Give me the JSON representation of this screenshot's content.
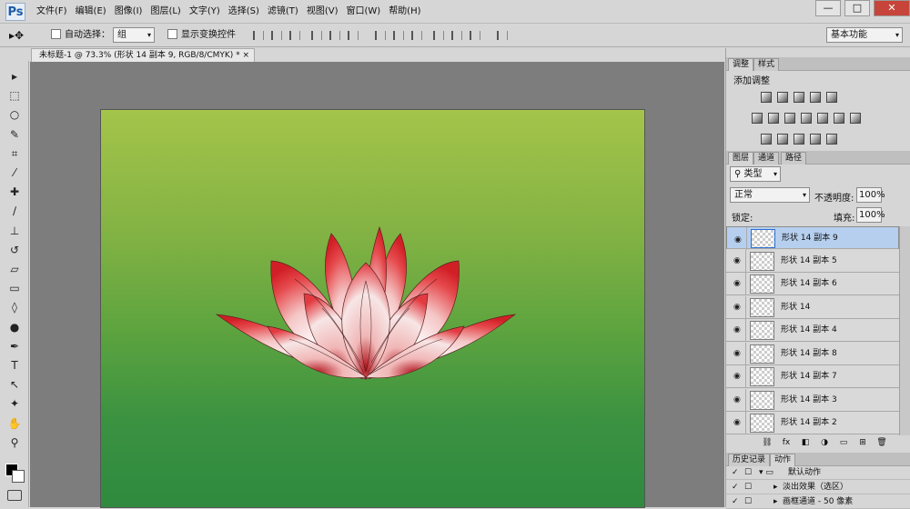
{
  "app": {
    "logo": "Ps"
  },
  "menu": [
    "文件(F)",
    "编辑(E)",
    "图像(I)",
    "图层(L)",
    "文字(Y)",
    "选择(S)",
    "滤镜(T)",
    "视图(V)",
    "窗口(W)",
    "帮助(H)"
  ],
  "window_controls": {
    "minimize": "—",
    "restore": "□",
    "close": "✕"
  },
  "options": {
    "auto_select_label": "自动选择：",
    "auto_select_value": "组",
    "show_transform_label": "显示变换控件",
    "workspace_value": "基本功能"
  },
  "document": {
    "tab_title": "未标题-1 @ 73.3% (形状 14 副本 9, RGB/8/CMYK) *",
    "close": "×"
  },
  "tools": [
    {
      "name": "move-tool-icon",
      "glyph": "▸"
    },
    {
      "name": "marquee-tool-icon",
      "glyph": "⬚"
    },
    {
      "name": "lasso-tool-icon",
      "glyph": "○"
    },
    {
      "name": "quick-select-tool-icon",
      "glyph": "✎"
    },
    {
      "name": "crop-tool-icon",
      "glyph": "⌗"
    },
    {
      "name": "eyedropper-tool-icon",
      "glyph": "⁄"
    },
    {
      "name": "healing-brush-tool-icon",
      "glyph": "✚"
    },
    {
      "name": "brush-tool-icon",
      "glyph": "∕"
    },
    {
      "name": "clone-stamp-tool-icon",
      "glyph": "⊥"
    },
    {
      "name": "history-brush-tool-icon",
      "glyph": "↺"
    },
    {
      "name": "eraser-tool-icon",
      "glyph": "▱"
    },
    {
      "name": "gradient-tool-icon",
      "glyph": "▭"
    },
    {
      "name": "blur-tool-icon",
      "glyph": "◊"
    },
    {
      "name": "dodge-tool-icon",
      "glyph": "●"
    },
    {
      "name": "pen-tool-icon",
      "glyph": "✒"
    },
    {
      "name": "type-tool-icon",
      "glyph": "T"
    },
    {
      "name": "path-select-tool-icon",
      "glyph": "↖"
    },
    {
      "name": "shape-tool-icon",
      "glyph": "✦"
    },
    {
      "name": "hand-tool-icon",
      "glyph": "✋"
    },
    {
      "name": "zoom-tool-icon",
      "glyph": "⚲"
    }
  ],
  "adjustments": {
    "tabs": [
      "调整",
      "样式"
    ],
    "title": "添加调整"
  },
  "layers_panel": {
    "tabs": [
      "图层",
      "通道",
      "路径"
    ],
    "filter_kind": "类型",
    "blend_mode": "正常",
    "opacity_label": "不透明度:",
    "opacity_value": "100%",
    "lock_label": "锁定:",
    "fill_label": "填充:",
    "fill_value": "100%",
    "layers": [
      {
        "name": "形状 14 副本 9",
        "selected": true
      },
      {
        "name": "形状 14 副本 5",
        "selected": false
      },
      {
        "name": "形状 14 副本 6",
        "selected": false
      },
      {
        "name": "形状 14",
        "selected": false
      },
      {
        "name": "形状 14 副本 4",
        "selected": false
      },
      {
        "name": "形状 14 副本 8",
        "selected": false
      },
      {
        "name": "形状 14 副本 7",
        "selected": false
      },
      {
        "name": "形状 14 副本 3",
        "selected": false
      },
      {
        "name": "形状 14 副本 2",
        "selected": false
      }
    ],
    "footer_icons": [
      "link-icon",
      "fx-icon",
      "mask-icon",
      "adjustment-layer-icon",
      "group-icon",
      "new-layer-icon",
      "trash-icon"
    ]
  },
  "actions_panel": {
    "tabs": [
      "历史记录",
      "动作"
    ],
    "rows": [
      "默认动作",
      "淡出效果（选区）",
      "画框通道 - 50 像素"
    ]
  }
}
